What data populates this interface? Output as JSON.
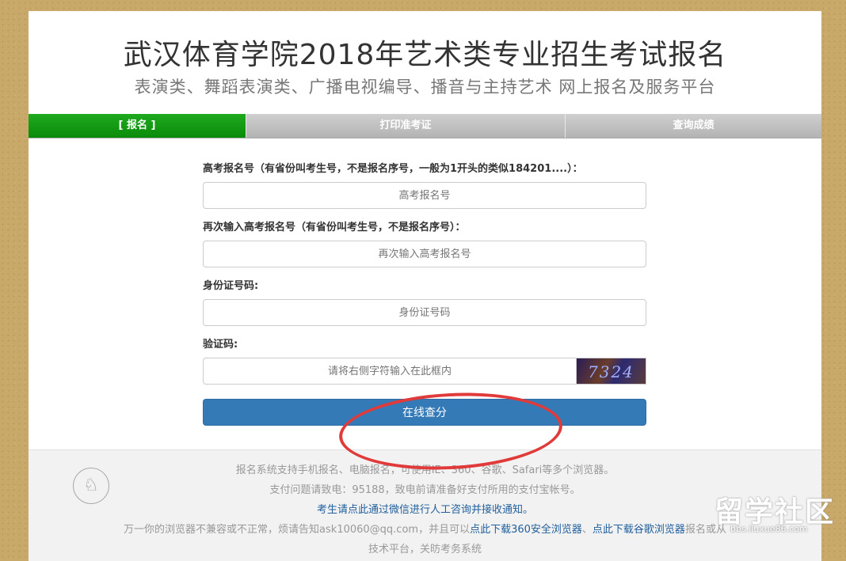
{
  "header": {
    "title": "武汉体育学院2018年艺术类专业招生考试报名",
    "subtitle": "表演类、舞蹈表演类、广播电视编导、播音与主持艺术  网上报名及服务平台"
  },
  "steps": [
    {
      "label": "[ 报名 ]",
      "active": true
    },
    {
      "label": "打印准考证",
      "active": false
    },
    {
      "label": "查询成绩",
      "active": false
    }
  ],
  "form": {
    "exam_id_label": "高考报名号（有省份叫考生号，不是报名序号，一般为1开头的类似184201....）：",
    "exam_id_placeholder": "高考报名号",
    "exam_id_confirm_label": "再次输入高考报名号（有省份叫考生号，不是报名序号）：",
    "exam_id_confirm_placeholder": "再次输入高考报名号",
    "id_card_label": "身份证号码:",
    "id_card_placeholder": "身份证号码",
    "captcha_label": "验证码:",
    "captcha_placeholder": "请将右侧字符输入在此框内",
    "captcha_text": "7324",
    "submit_label": "在线查分"
  },
  "footer": {
    "line1": "报名系统支持手机报名、电脑报名，可使用IE、360、谷歌、Safari等多个浏览器。",
    "line2": "支付问题请致电：95188，致电前请准备好支付所用的支付宝帐号。",
    "line3": "考生请点此通过微信进行人工咨询并接收通知。",
    "line4_prefix": "万一你的浏览器不兼容或不正常，烦请告知ask10060@qq.com，并且可以",
    "line4_link1": "点此下载360安全浏览器",
    "line4_sep": "、",
    "line4_link2": "点此下载谷歌浏览器",
    "line4_suffix": "报名或从",
    "line5": "技术平台，关昉考务系统"
  },
  "watermark": {
    "big": "留学社区",
    "small": "bbs.liuxue86.com"
  },
  "colors": {
    "active_step": "#119911",
    "inactive_step": "#bdbdbd",
    "submit": "#337ab7",
    "annotation": "#e03a3a"
  }
}
